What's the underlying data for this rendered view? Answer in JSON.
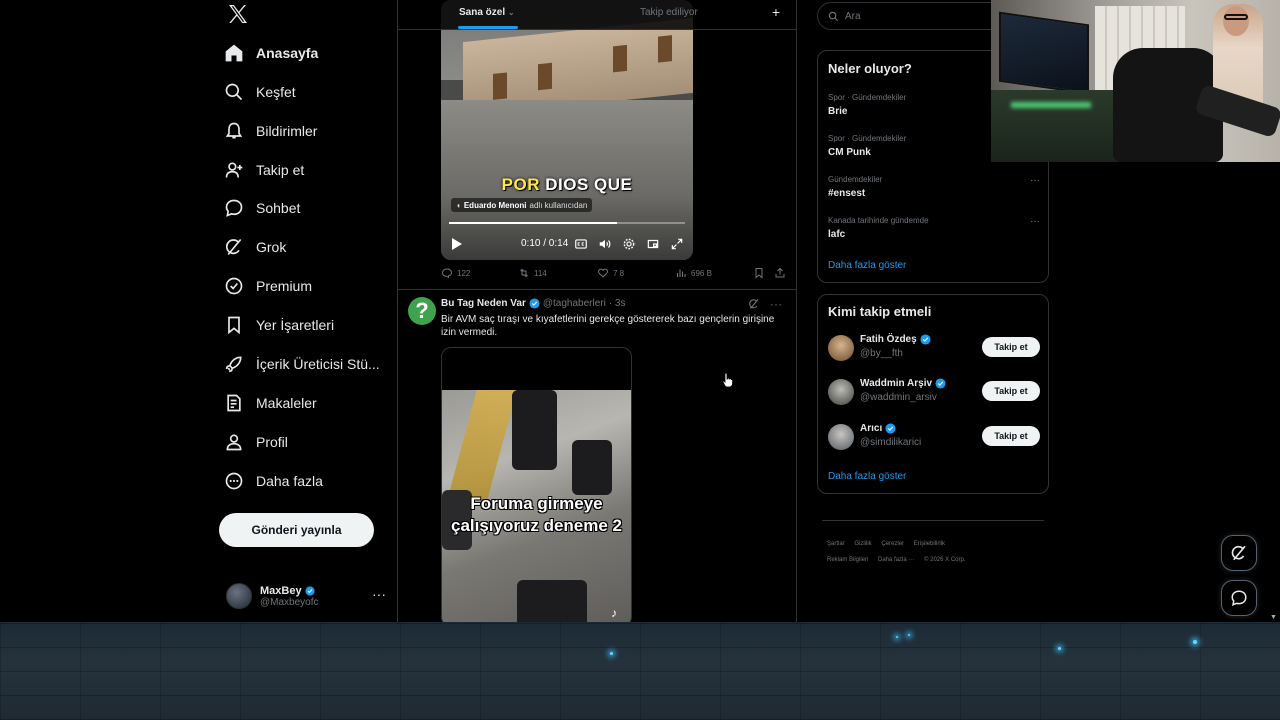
{
  "nav": {
    "items": [
      {
        "label": "Anasayfa",
        "icon": "home-icon"
      },
      {
        "label": "Keşfet",
        "icon": "search-icon"
      },
      {
        "label": "Bildirimler",
        "icon": "bell-icon"
      },
      {
        "label": "Takip et",
        "icon": "add-user-icon"
      },
      {
        "label": "Sohbet",
        "icon": "chat-icon"
      },
      {
        "label": "Grok",
        "icon": "grok-icon"
      },
      {
        "label": "Premium",
        "icon": "premium-icon"
      },
      {
        "label": "Yer İşaretleri",
        "icon": "bookmark-icon"
      },
      {
        "label": "İçerik Üreticisi Stü...",
        "icon": "rocket-icon"
      },
      {
        "label": "Makaleler",
        "icon": "article-icon"
      },
      {
        "label": "Profil",
        "icon": "profile-icon"
      },
      {
        "label": "Daha fazla",
        "icon": "more-circle-icon"
      }
    ],
    "post_button": "Gönderi yayınla",
    "account": {
      "name": "MaxBey",
      "handle": "@Maxbeyofc",
      "more": "···"
    }
  },
  "tabs": {
    "for_you": "Sana özel",
    "following": "Takip ediliyor",
    "add": "+"
  },
  "video1": {
    "subtitle_a": "POR",
    "subtitle_b": "DIOS QUE",
    "credit_name": "Eduardo Menoni",
    "credit_suffix": "adlı kullanıcıdan",
    "time": "0:10 / 0:14",
    "progress": 0.71
  },
  "tweet1_stats": {
    "replies": "122",
    "reposts": "114",
    "likes": "7 8",
    "views": "696 B"
  },
  "tweet2": {
    "name": "Bu Tag Neden Var",
    "handle": "@taghaberleri",
    "time": "· 3s",
    "avatar_char": "?",
    "text": "Bir AVM saç tıraşı ve kıyafetlerini gerekçe göstererek bazı gençlerin girişine izin vermedi.",
    "caption": "Foruma girmeye çalışıyoruz deneme 2",
    "more": "···"
  },
  "search": {
    "placeholder": "Ara"
  },
  "trends": {
    "title": "Neler oluyor?",
    "items": [
      {
        "meta": "Spor · Gündemdekiler",
        "name": "Brie"
      },
      {
        "meta": "Spor · Gündemdekiler",
        "name": "CM Punk"
      },
      {
        "meta": "Gündemdekiler",
        "name": "#ensest"
      },
      {
        "meta": "Kanada tarihinde gündemde",
        "name": "lafc"
      }
    ],
    "dots": "···",
    "more": "Daha fazla göster"
  },
  "who_to_follow": {
    "title": "Kimi takip etmeli",
    "users": [
      {
        "name": "Fatih Özdeş",
        "handle": "@by__fth",
        "button": "Takip et"
      },
      {
        "name": "Waddmin Arşiv",
        "handle": "@waddmin_arsiv",
        "button": "Takip et"
      },
      {
        "name": "Arıcı",
        "handle": "@simdilikarici",
        "button": "Takip et"
      }
    ],
    "more": "Daha fazla göster"
  },
  "footer": {
    "links": [
      "Şartlar",
      "Gizlilik",
      "Çerezler",
      "Erişilebilirlik",
      "Reklam Bilgileri",
      "Daha fazla ···",
      "© 2026 X Corp."
    ]
  },
  "colors": {
    "accent": "#1d9bf0",
    "verified": "#1d9bf0",
    "background": "#000000",
    "border": "#2f3336",
    "muted": "#71767b"
  }
}
